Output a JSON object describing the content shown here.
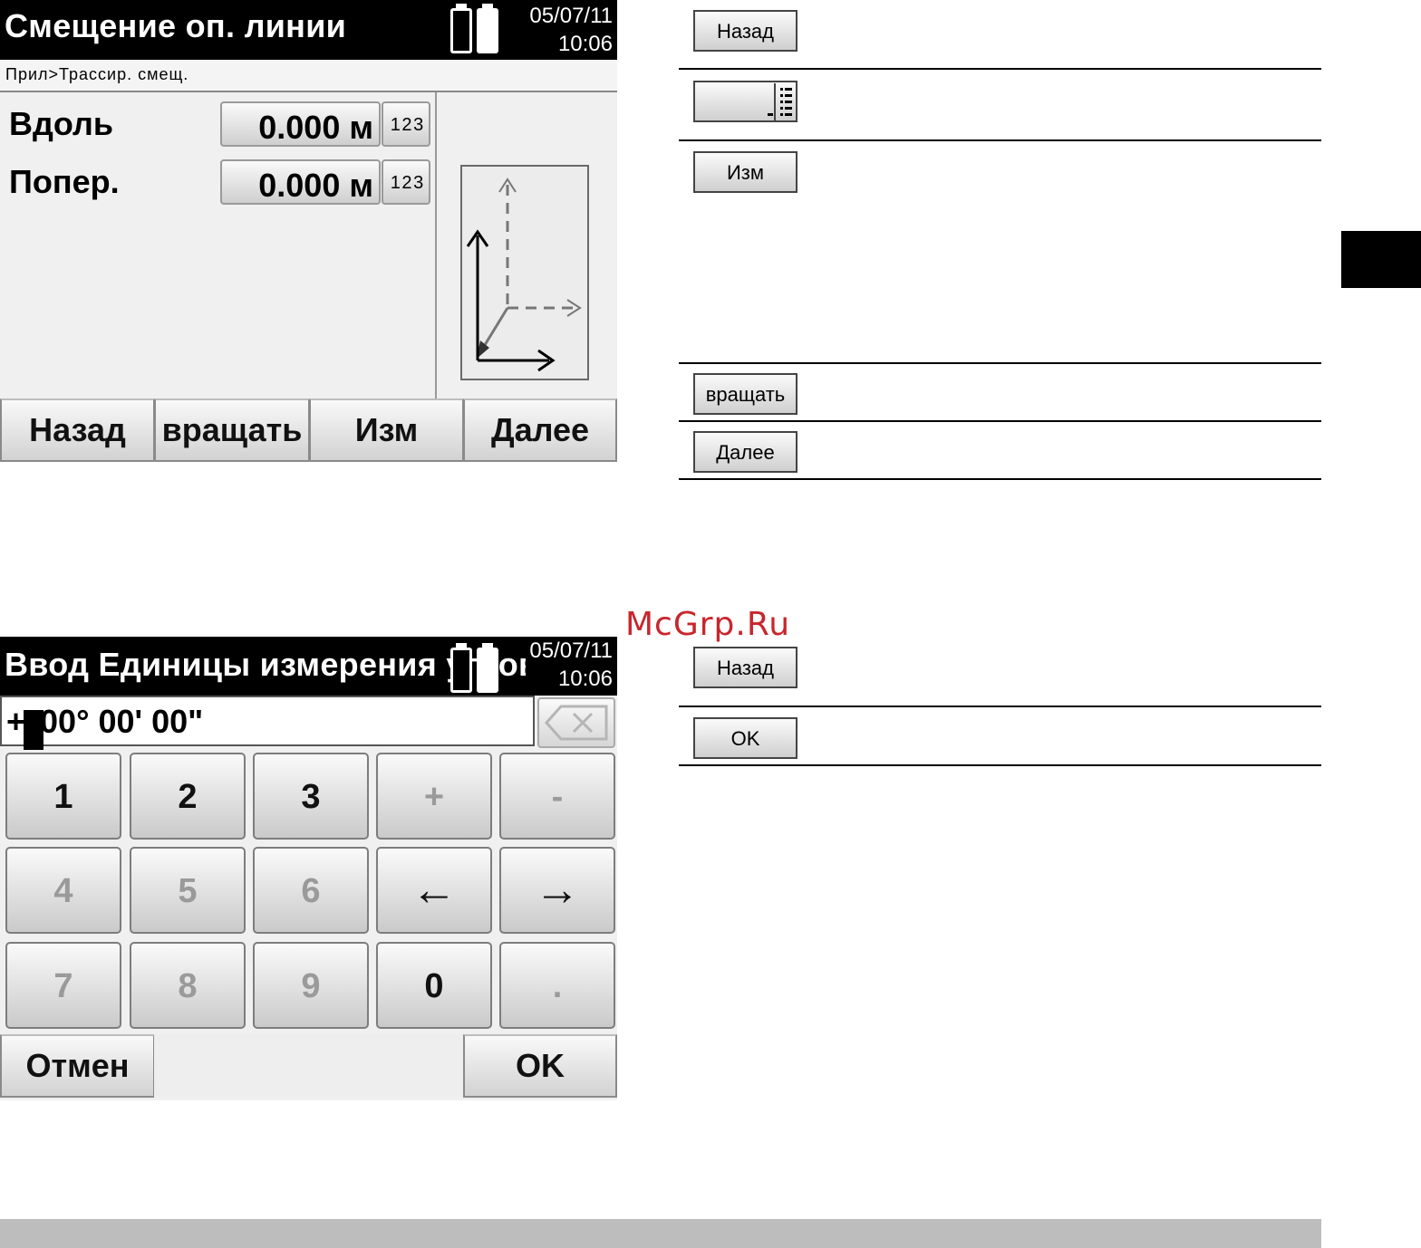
{
  "screen1": {
    "title": "Смещение оп. линии",
    "date": "05/07/11",
    "time": "10:06",
    "breadcrumb": "Прил>Трассир. смещ.",
    "fields": [
      {
        "label": "Вдоль",
        "value": "0.000 м",
        "numpad": "1 2 3"
      },
      {
        "label": "Попер.",
        "value": "0.000 м",
        "numpad": "1 2 3"
      }
    ],
    "softkeys": [
      "Назад",
      "вращать",
      "Изм",
      "Далее"
    ]
  },
  "screen2": {
    "title": "Ввод Единицы измерения углов",
    "date": "05/07/11",
    "time": "10:06",
    "input_prefix": "+",
    "input_cursor_char": "0",
    "input_rest": "00° 00' 00\"",
    "keys": [
      {
        "label": "1",
        "enabled": true
      },
      {
        "label": "2",
        "enabled": true
      },
      {
        "label": "3",
        "enabled": true
      },
      {
        "label": "+",
        "enabled": false
      },
      {
        "label": "-",
        "enabled": false
      },
      {
        "label": "4",
        "enabled": false
      },
      {
        "label": "5",
        "enabled": false
      },
      {
        "label": "6",
        "enabled": false
      },
      {
        "label": "←",
        "enabled": true
      },
      {
        "label": "→",
        "enabled": true
      },
      {
        "label": "7",
        "enabled": false
      },
      {
        "label": "8",
        "enabled": false
      },
      {
        "label": "9",
        "enabled": false
      },
      {
        "label": "0",
        "enabled": true
      },
      {
        "label": ".",
        "enabled": false
      }
    ],
    "softkeys": [
      "Отмен",
      "",
      "OK"
    ]
  },
  "legend1": {
    "back": "Назад",
    "edit": "Изм",
    "rotate": "вращать",
    "next": "Далее"
  },
  "legend2": {
    "back": "Назад",
    "ok": "OK"
  },
  "watermark": "McGrp.Ru"
}
